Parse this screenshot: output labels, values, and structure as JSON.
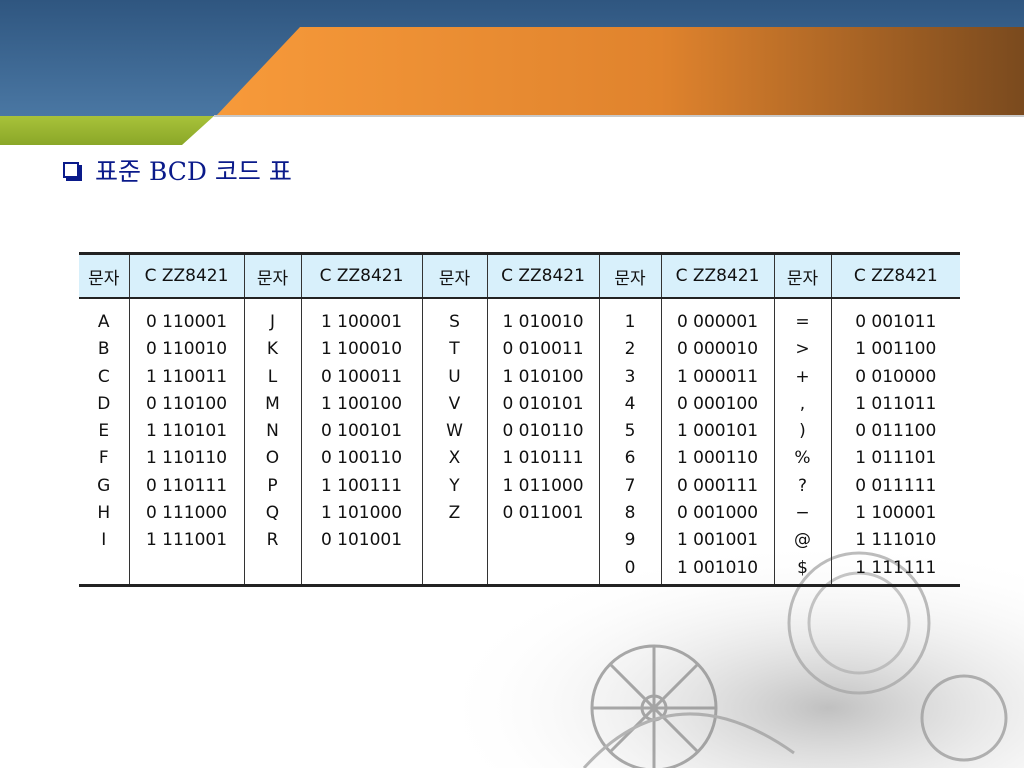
{
  "title": "표준 BCD 코드 표",
  "table": {
    "headers": [
      "문자",
      "C ZZ8421",
      "문자",
      "C ZZ8421",
      "문자",
      "C ZZ8421",
      "문자",
      "C ZZ8421",
      "문자",
      "C ZZ8421"
    ],
    "groups": [
      {
        "chars": [
          "A",
          "B",
          "C",
          "D",
          "E",
          "F",
          "G",
          "H",
          "I"
        ],
        "codes": [
          "0 110001",
          "0 110010",
          "1 110011",
          "0 110100",
          "1 110101",
          "1 110110",
          "0 110111",
          "0 111000",
          "1 111001"
        ]
      },
      {
        "chars": [
          "J",
          "K",
          "L",
          "M",
          "N",
          "O",
          "P",
          "Q",
          "R"
        ],
        "codes": [
          "1 100001",
          "1 100010",
          "0 100011",
          "1 100100",
          "0 100101",
          "0 100110",
          "1 100111",
          "1 101000",
          "0 101001"
        ]
      },
      {
        "chars": [
          "S",
          "T",
          "U",
          "V",
          "W",
          "X",
          "Y",
          "Z"
        ],
        "codes": [
          "1 010010",
          "0 010011",
          "1 010100",
          "0 010101",
          "0 010110",
          "1 010111",
          "1 011000",
          "0 011001"
        ]
      },
      {
        "chars": [
          "1",
          "2",
          "3",
          "4",
          "5",
          "6",
          "7",
          "8",
          "9",
          "0"
        ],
        "codes": [
          "0 000001",
          "0 000010",
          "1 000011",
          "0 000100",
          "1 000101",
          "1 000110",
          "0 000111",
          "0 001000",
          "1 001001",
          "1 001010"
        ]
      },
      {
        "chars": [
          "=",
          ">",
          "+",
          ",",
          ")",
          "%",
          "?",
          "−",
          "@",
          "$"
        ],
        "codes": [
          "0 001011",
          "1 001100",
          "0 010000",
          "1 011011",
          "0 011100",
          "1 011101",
          "0 011111",
          "1 100001",
          "1 111010",
          "1 111111"
        ]
      }
    ]
  },
  "colors": {
    "banner_blue": "#3f6a95",
    "banner_orange": "#f08f33",
    "banner_green": "#9ab52e",
    "title_text": "#0a1a8a",
    "header_fill": "#d8f0fb"
  },
  "icons": {
    "bullet": "square-bullet-icon"
  }
}
